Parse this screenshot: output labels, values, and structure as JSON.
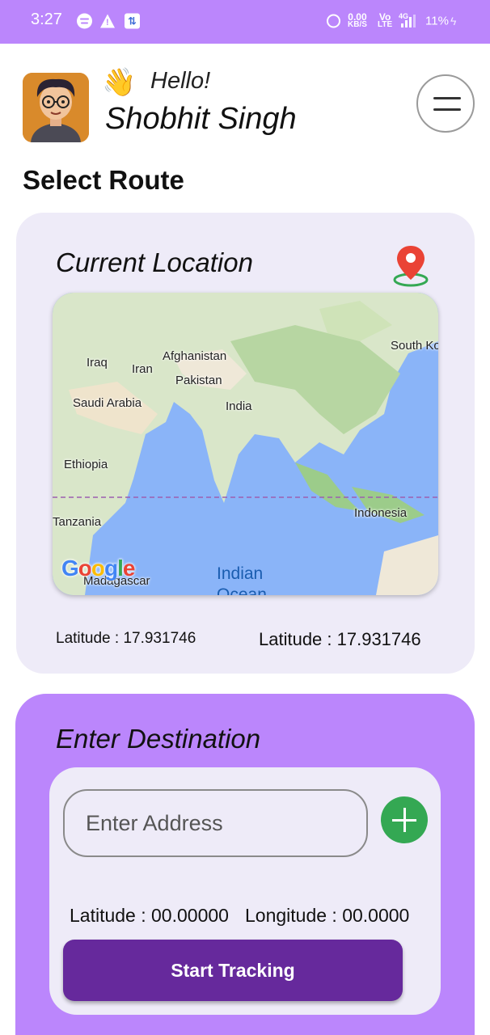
{
  "status_bar": {
    "time": "3:27",
    "network_speed_value": "0.00",
    "network_speed_unit": "KB/S",
    "volte_top": "Vo",
    "volte_bottom": "LTE",
    "network_type": "4G",
    "battery": "11%"
  },
  "header": {
    "greeting_emoji": "👋",
    "greeting": "Hello!",
    "user_name": "Shobhit Singh"
  },
  "page_title": "Select Route",
  "current_location": {
    "title": "Current Location",
    "map_labels": {
      "iraq": "Iraq",
      "iran": "Iran",
      "afghanistan": "Afghanistan",
      "pakistan": "Pakistan",
      "india": "India",
      "saudi_arabia": "Saudi Arabia",
      "ethiopia": "Ethiopia",
      "tanzania": "Tanzania",
      "madagascar": "Madagascar",
      "indonesia": "Indonesia",
      "south_korea": "South Ko",
      "indian_ocean": "Indian",
      "indian_ocean_2": "Ocean"
    },
    "map_logo": "Google",
    "coord_left": "Latitude : 17.931746",
    "coord_right": "Latitude : 17.931746"
  },
  "destination": {
    "title": "Enter Destination",
    "address_placeholder": "Enter Address",
    "latitude": "Latitude : 00.00000",
    "longitude": "Longitude : 00.0000",
    "start_button": "Start Tracking"
  },
  "colors": {
    "status_bar": "#bb86fc",
    "card_bg": "#eeebf8",
    "accent_purple": "#bb86fc",
    "button_purple": "#66299c",
    "add_green": "#34a853",
    "pin_red": "#ea4335"
  }
}
